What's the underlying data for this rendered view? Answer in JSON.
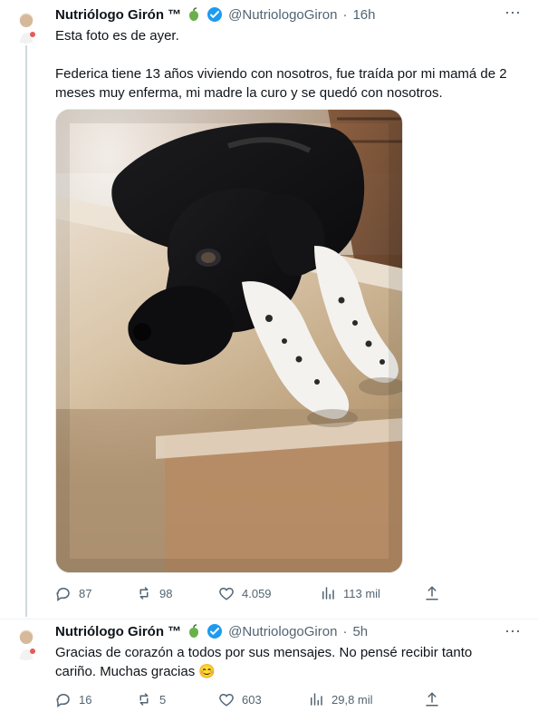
{
  "tweets": [
    {
      "name": "Nutriólogo Girón ™",
      "handle": "@NutriologoGiron",
      "time": "16h",
      "text_lines": [
        "Esta foto es de ayer.",
        "",
        "Federica tiene 13 años viviendo con nosotros, fue traída por mi mamá de 2",
        "meses muy enferma, mi madre la curo y se quedó con nosotros."
      ],
      "replies": "87",
      "reposts": "98",
      "likes": "4.059",
      "views": "113 mil"
    },
    {
      "name": "Nutriólogo Girón ™",
      "handle": "@NutriologoGiron",
      "time": "5h",
      "text_lines": [
        "Gracias de corazón a todos por sus mensajes. No pensé recibir tanto",
        "cariño. Muchas gracias 😊"
      ],
      "replies": "16",
      "reposts": "5",
      "likes": "603",
      "views": "29,8 mil"
    }
  ],
  "icons": {
    "apple": "green-apple-icon",
    "verified": "verified-badge-icon",
    "more": "more-options-icon"
  },
  "colors": {
    "verified": "#1d9bf0",
    "muted": "#536471",
    "apple": "#6ab04c"
  }
}
